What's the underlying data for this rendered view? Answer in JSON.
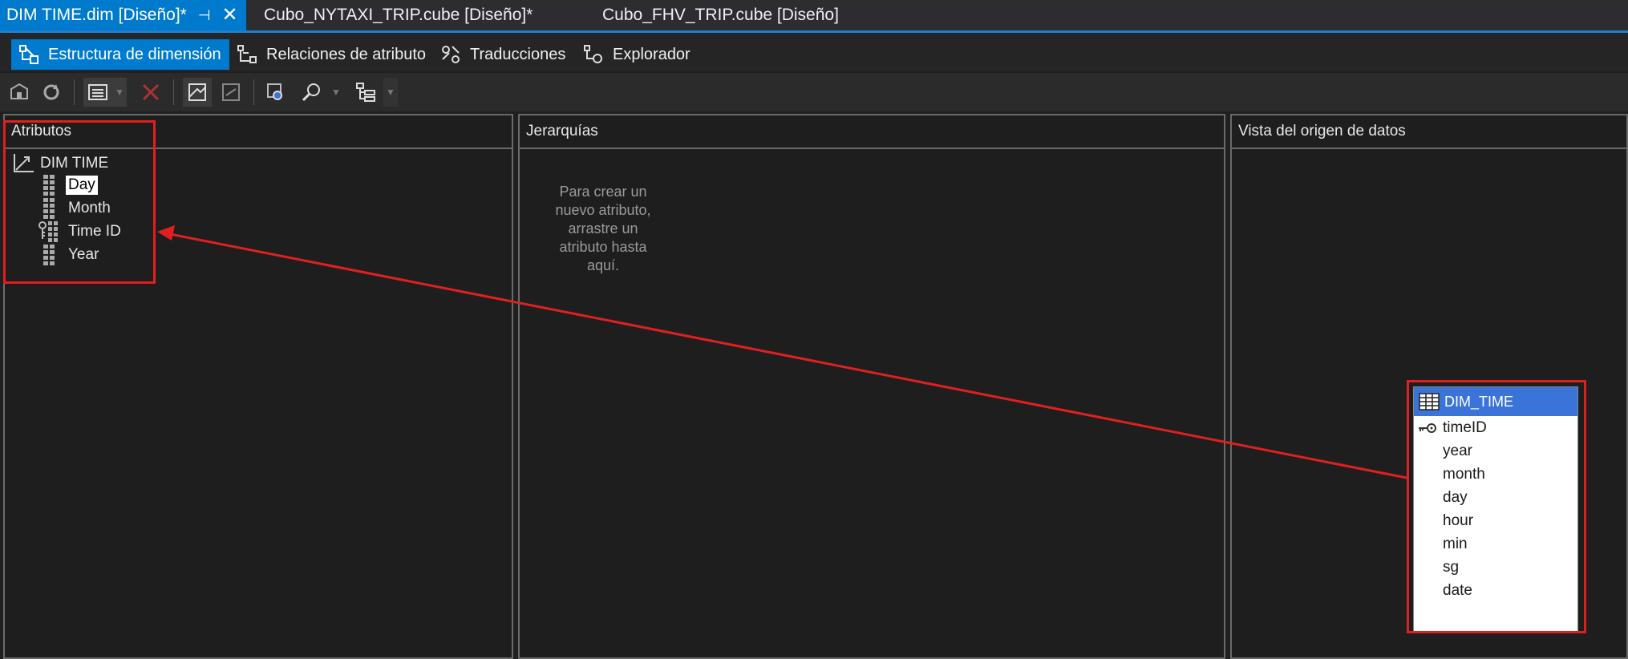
{
  "tabs": [
    {
      "label": "DIM TIME.dim [Diseño]*",
      "active": true
    },
    {
      "label": "Cubo_NYTAXI_TRIP.cube [Diseño]*",
      "active": false
    },
    {
      "label": "Cubo_FHV_TRIP.cube [Diseño]",
      "active": false
    }
  ],
  "view_tabs": [
    {
      "label": "Estructura de dimensión",
      "icon": "dimension-structure-icon"
    },
    {
      "label": "Relaciones de atributo",
      "icon": "attribute-relations-icon"
    },
    {
      "label": "Traducciones",
      "icon": "translations-icon"
    },
    {
      "label": "Explorador",
      "icon": "browser-icon"
    }
  ],
  "attributes_pane": {
    "header": "Atributos",
    "dimension": "DIM TIME",
    "items": [
      {
        "label": "Day",
        "icon": "attribute-icon",
        "selected": true
      },
      {
        "label": "Month",
        "icon": "attribute-icon"
      },
      {
        "label": "Time ID",
        "icon": "key-attribute-icon"
      },
      {
        "label": "Year",
        "icon": "attribute-icon"
      }
    ]
  },
  "hierarchies_pane": {
    "header": "Jerarquías",
    "placeholder_lines": [
      "Para crear un",
      "nuevo atributo,",
      "arrastre un",
      "atributo hasta",
      "aquí."
    ]
  },
  "dsv_pane": {
    "header": "Vista del origen de datos",
    "table": {
      "name": "DIM_TIME",
      "columns": [
        {
          "name": "timeID",
          "key": true
        },
        {
          "name": "year"
        },
        {
          "name": "month"
        },
        {
          "name": "day"
        },
        {
          "name": "hour"
        },
        {
          "name": "min"
        },
        {
          "name": "sg"
        },
        {
          "name": "date"
        }
      ]
    }
  },
  "colors": {
    "accent": "#007acc",
    "annotation": "#e02020",
    "table_header": "#3a74d9"
  }
}
